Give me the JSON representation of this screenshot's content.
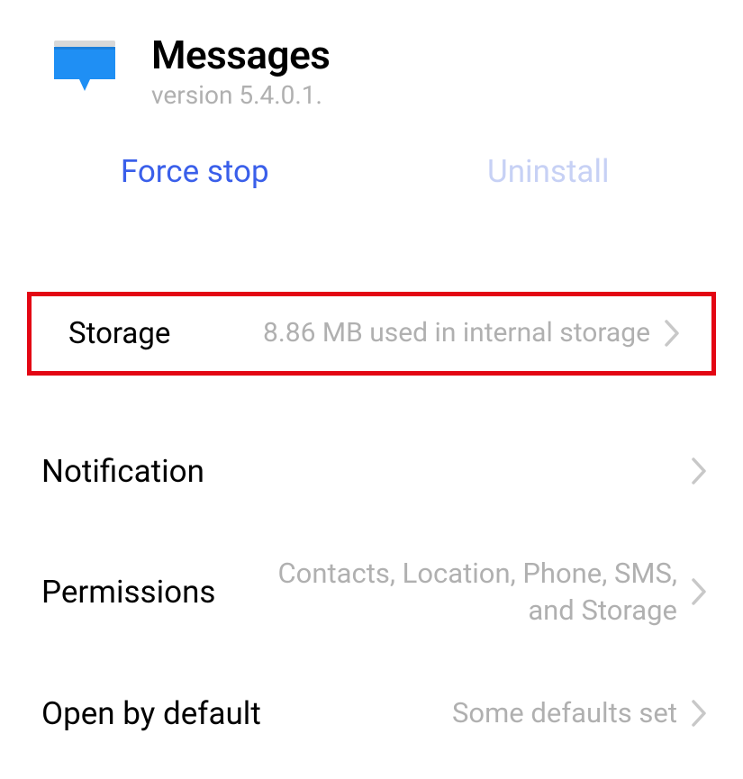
{
  "app": {
    "title": "Messages",
    "version": "version 5.4.0.1."
  },
  "actions": {
    "force_stop": "Force stop",
    "uninstall": "Uninstall"
  },
  "items": {
    "storage": {
      "label": "Storage",
      "value": "8.86 MB used in internal storage"
    },
    "notification": {
      "label": "Notification",
      "value": ""
    },
    "permissions": {
      "label": "Permissions",
      "value": "Contacts, Location, Phone, SMS, and Storage"
    },
    "open_by_default": {
      "label": "Open by default",
      "value": "Some defaults set"
    }
  },
  "highlight": {
    "color": "#e30613"
  }
}
